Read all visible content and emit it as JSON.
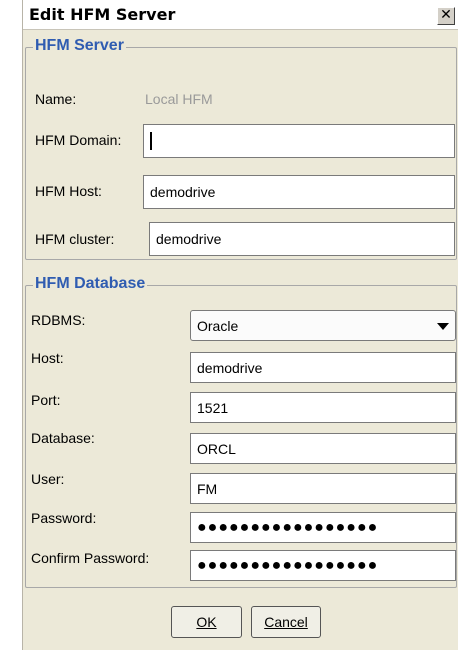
{
  "window": {
    "title": "Edit HFM Server",
    "close_glyph": "✕"
  },
  "server_group": {
    "title": "HFM Server",
    "name_label": "Name:",
    "name_value": "Local HFM",
    "domain_label": "HFM Domain:",
    "domain_value": "",
    "host_label": "HFM Host:",
    "host_value": "demodrive",
    "cluster_label": "HFM cluster:",
    "cluster_value": "demodrive"
  },
  "database_group": {
    "title": "HFM Database",
    "rdbms_label": "RDBMS:",
    "rdbms_value": "Oracle",
    "host_label": "Host:",
    "host_value": "demodrive",
    "port_label": "Port:",
    "port_value": "1521",
    "database_label": "Database:",
    "database_value": "ORCL",
    "user_label": "User:",
    "user_value": "FM",
    "password_label": "Password:",
    "password_value": "●●●●●●●●●●●●●●●●●",
    "confirm_label": "Confirm Password:",
    "confirm_value": "●●●●●●●●●●●●●●●●●"
  },
  "buttons": {
    "ok": "OK",
    "cancel": "Cancel"
  }
}
